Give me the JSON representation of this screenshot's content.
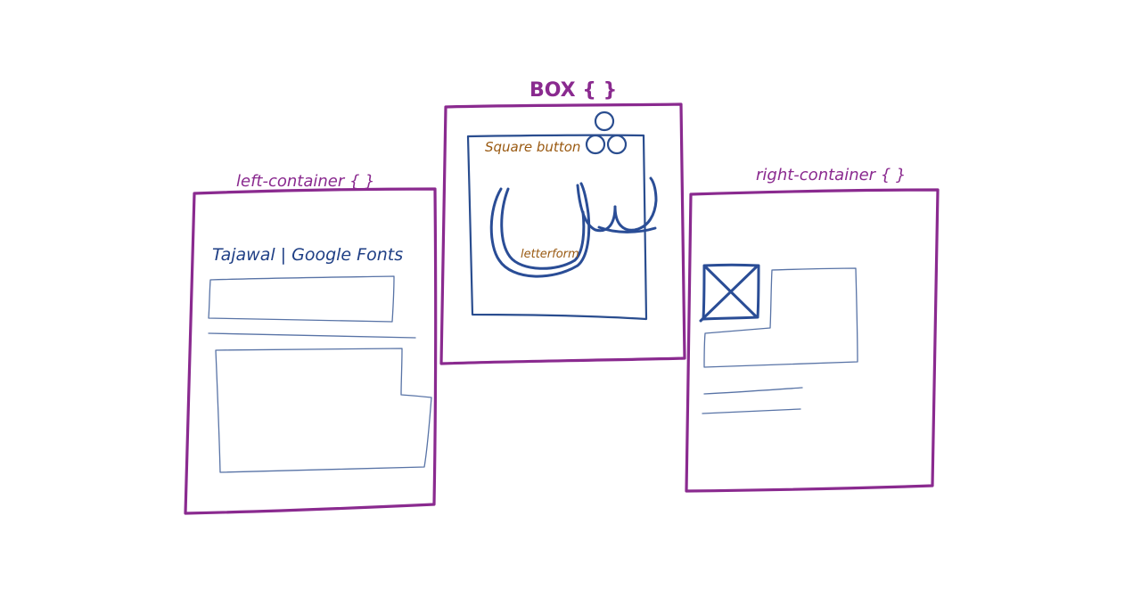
{
  "labels": {
    "box": "BOX { }",
    "left_container": "left-container { }",
    "right_container": "right-container { }",
    "square_button": "Square button",
    "letterform": "letterform",
    "font_title": "Tajawal | Google Fonts"
  },
  "colors": {
    "container_outline": "#8a2a8f",
    "wireframe_ink": "#2a4d8f",
    "annotation_ink": "#9a5a12"
  },
  "icons": {
    "image_placeholder": "crossed-box-icon",
    "dots": "three-dots-diacritic-icon"
  }
}
